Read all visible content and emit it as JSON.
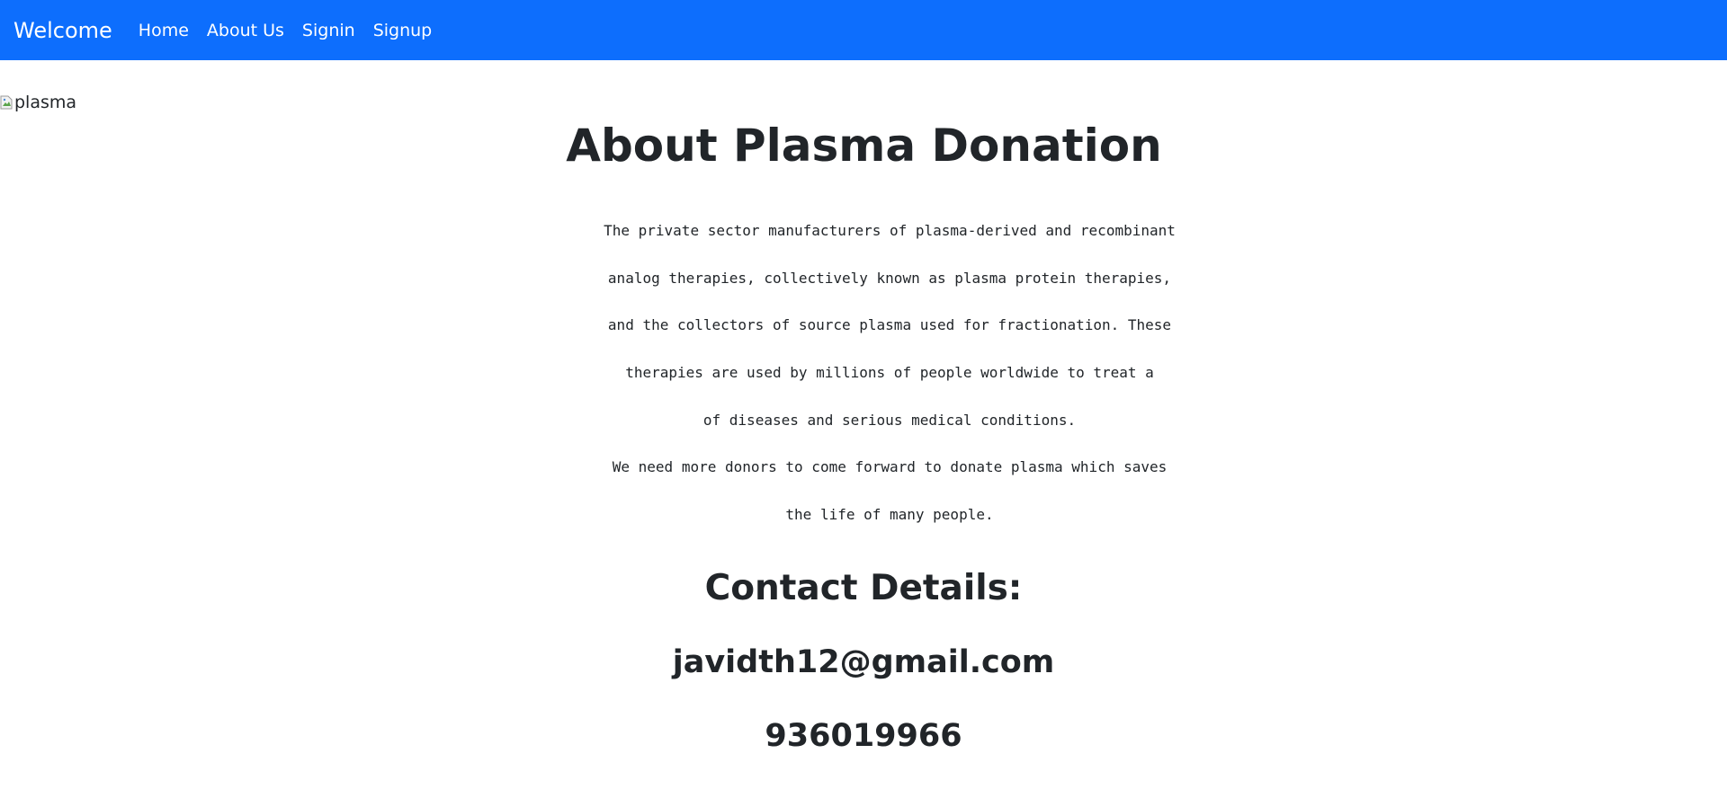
{
  "navbar": {
    "brand": "Welcome",
    "links": [
      "Home",
      "About Us",
      "Signin",
      "Signup"
    ],
    "background_color": "#0d6efd"
  },
  "hero_image": {
    "alt": "plasma",
    "state": "broken-image-icon"
  },
  "about": {
    "title": "About Plasma Donation",
    "description_lines": [
      "The private sector manufacturers of plasma-derived and recombinant",
      "analog therapies, collectively known as plasma protein therapies,",
      "and the collectors of source plasma used for fractionation. These",
      "therapies are used by millions of people worldwide to treat a",
      "of diseases and serious medical conditions.",
      "We need more donors to come forward to donate plasma which saves",
      "the life of many people."
    ]
  },
  "contact": {
    "heading": "Contact Details:",
    "email": "javidth12@gmail.com",
    "phone": "936019966"
  }
}
